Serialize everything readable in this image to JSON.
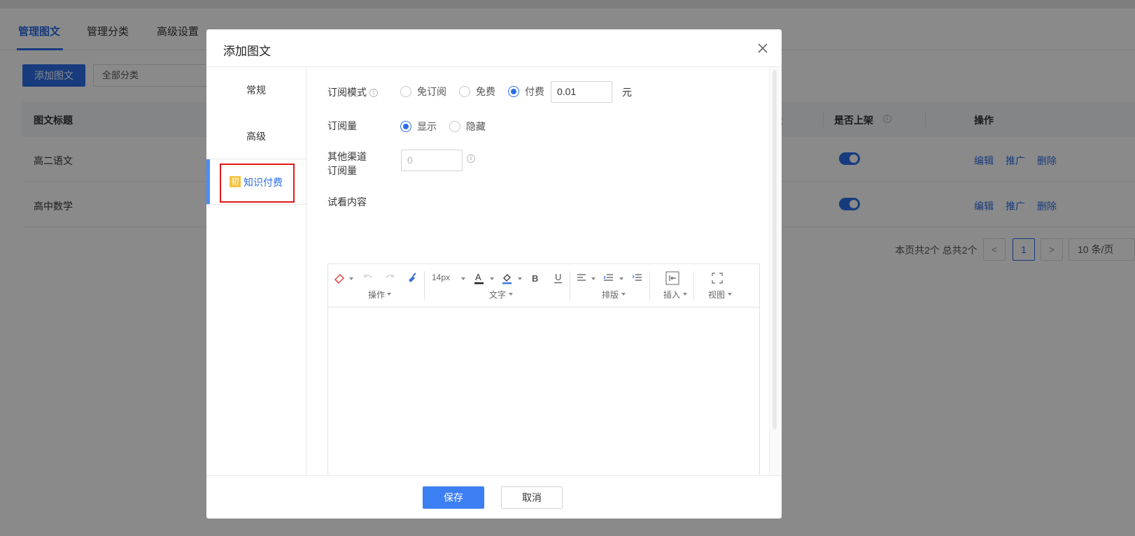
{
  "tabs": [
    {
      "label": "管理图文",
      "active": true
    },
    {
      "label": "管理分类",
      "active": false
    },
    {
      "label": "高级设置",
      "active": false
    }
  ],
  "toolbar": {
    "add_label": "添加图文",
    "category_value": "全部分类"
  },
  "table": {
    "headers": [
      "图文标题",
      "量",
      "是否上架",
      "操作"
    ],
    "rows": [
      {
        "title": "高二语文",
        "listed": true,
        "ops": [
          "编辑",
          "推广",
          "删除"
        ]
      },
      {
        "title": "高中数学",
        "listed": true,
        "ops": [
          "编辑",
          "推广",
          "删除"
        ]
      }
    ]
  },
  "pagination": {
    "info": "本页共2个 总共2个",
    "prev": "<",
    "current": "1",
    "next": ">",
    "page_size": "10 条/页"
  },
  "modal": {
    "title": "添加图文",
    "side_items": [
      {
        "label": "常规",
        "active": false
      },
      {
        "label": "高级",
        "active": false
      },
      {
        "label": "知识付费",
        "active": true,
        "mark": "初"
      }
    ],
    "subscribe_mode": {
      "label": "订阅模式",
      "options": [
        "免订阅",
        "免费",
        "付费"
      ],
      "selected": "付费",
      "price_value": "0.01",
      "price_unit": "元"
    },
    "subscribe_count": {
      "label": "订阅量",
      "options": [
        "显示",
        "隐藏"
      ],
      "selected": "显示"
    },
    "other_channel": {
      "label_line1": "其他渠道",
      "label_line2": "订阅量",
      "placeholder": "0"
    },
    "preview": {
      "label": "试看内容"
    },
    "editor": {
      "font_size": "14px",
      "groups": [
        "操作",
        "文字",
        "排版",
        "插入",
        "视图"
      ]
    },
    "save_label": "保存",
    "cancel_label": "取消"
  },
  "colors": {
    "primary": "#2b6ee8",
    "highlight_box": "#e01919",
    "mark_bg": "#f4c542"
  }
}
